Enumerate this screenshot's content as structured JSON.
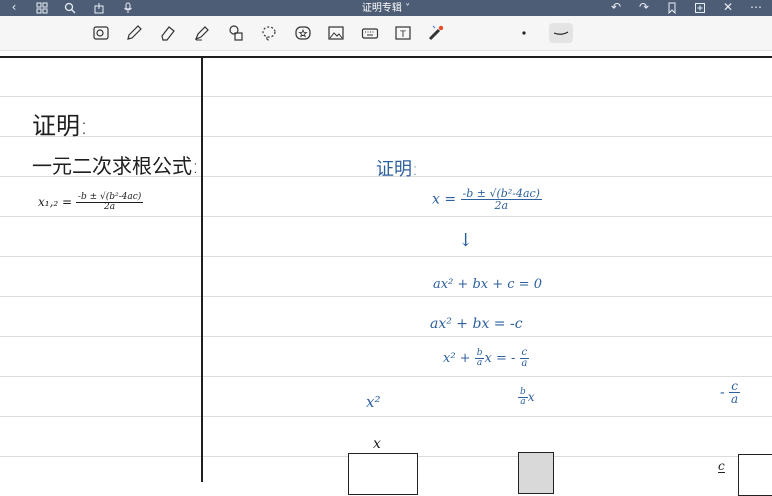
{
  "window": {
    "title": "证明专辑 ˅"
  },
  "nav_icons": [
    "back-icon",
    "grid-icon",
    "search-icon",
    "share-icon",
    "microphone-icon"
  ],
  "right_icons": [
    "undo-icon",
    "redo-icon",
    "bookmark-icon",
    "add-page-icon",
    "close-icon",
    "more-icon"
  ],
  "toolbar": {
    "tools": [
      "lasso-image-icon",
      "pen-icon",
      "eraser-icon",
      "highlighter-icon",
      "shapes-icon",
      "lasso-icon",
      "sticker-icon",
      "image-icon",
      "keyboard-icon",
      "text-box-icon",
      "laser-pointer-icon"
    ],
    "active_tool": "pen-icon",
    "colors": {
      "ink_black": "#1e1e1e",
      "ink_blue": "#2c5f9e",
      "topbar": "#4d5d75"
    }
  },
  "notes": {
    "left": {
      "heading": "证明:",
      "subheading": "一元二次求根公式:",
      "formula_lhs": "x₁,₂ =",
      "formula_num": "-b ± √(b²-4ac)",
      "formula_den": "2a"
    },
    "right": {
      "heading": "证明:",
      "line1_lhs": "x =",
      "line1_num": "-b ± √(b²-4ac)",
      "line1_den": "2a",
      "arrow": "↓",
      "eq1": "ax² + bx + c = 0",
      "eq2": "ax² + bx = -c",
      "eq3_a": "x² +",
      "eq3_frac_num": "b",
      "eq3_frac_den": "a",
      "eq3_b": "x = -",
      "eq3_rhs_num": "c",
      "eq3_rhs_den": "a",
      "term_x2": "x²",
      "term_bax_num": "b",
      "term_bax_den": "a",
      "term_bax_x": "x",
      "term_neg": "-",
      "term_ca_num": "c",
      "term_ca_den": "a",
      "box_label_x": "x",
      "small_c": "c"
    }
  }
}
